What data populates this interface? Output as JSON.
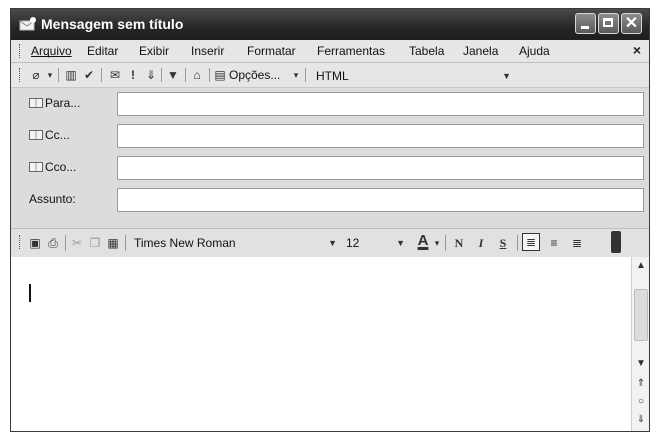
{
  "window": {
    "title": "Mensagem sem título"
  },
  "menu": {
    "items": [
      {
        "label": "Arquivo"
      },
      {
        "label": "Editar"
      },
      {
        "label": "Exibir"
      },
      {
        "label": "Inserir"
      },
      {
        "label": "Formatar"
      },
      {
        "label": "Ferramentas"
      },
      {
        "label": "Tabela"
      },
      {
        "label": "Janela"
      },
      {
        "label": "Ajuda"
      }
    ],
    "close_glyph": "×"
  },
  "toolbar1": {
    "options_label": "Opções...",
    "format_value": "HTML"
  },
  "fields": {
    "to_label": "Para...",
    "cc_label": "Cc...",
    "bcc_label": "Cco...",
    "subject_label": "Assunto:",
    "to_value": "",
    "cc_value": "",
    "bcc_value": "",
    "subject_value": ""
  },
  "toolbar2": {
    "font_name": "Times New Roman",
    "font_size": "12",
    "bold_label": "N",
    "italic_label": "I",
    "underline_label": "S"
  },
  "body": {
    "text": ""
  },
  "icons": {
    "attach": "paperclip-icon",
    "address_book": "address-book-icon",
    "check_names": "check-names-icon",
    "importance_high": "importance-high-icon",
    "importance_low": "importance-low-icon",
    "flag": "flag-icon",
    "save": "save-icon",
    "print": "print-icon",
    "cut": "cut-icon",
    "copy": "copy-icon",
    "paste": "paste-icon",
    "font_color": "font-color-icon",
    "align_left": "align-left-icon",
    "align_center": "align-center-icon",
    "align_right": "align-right-icon"
  }
}
